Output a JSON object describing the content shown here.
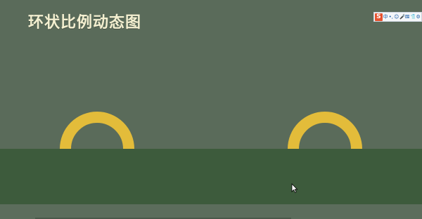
{
  "title": "环状比例动态图",
  "colors": {
    "background": "#5a6b5a",
    "ground": "#3d5b3c",
    "ring": "#e3bc3a",
    "title": "#f3efd0"
  },
  "ime_toolbar": {
    "logo": "S",
    "items": [
      "中",
      "•,",
      "☺",
      "🎤",
      "⌨",
      "👕",
      "⚙"
    ]
  },
  "ime_icons": [
    "sogou-logo-icon",
    "chinese-mode-icon",
    "punctuation-icon",
    "emoji-icon",
    "voice-icon",
    "keyboard-icon",
    "skin-icon",
    "settings-icon"
  ]
}
